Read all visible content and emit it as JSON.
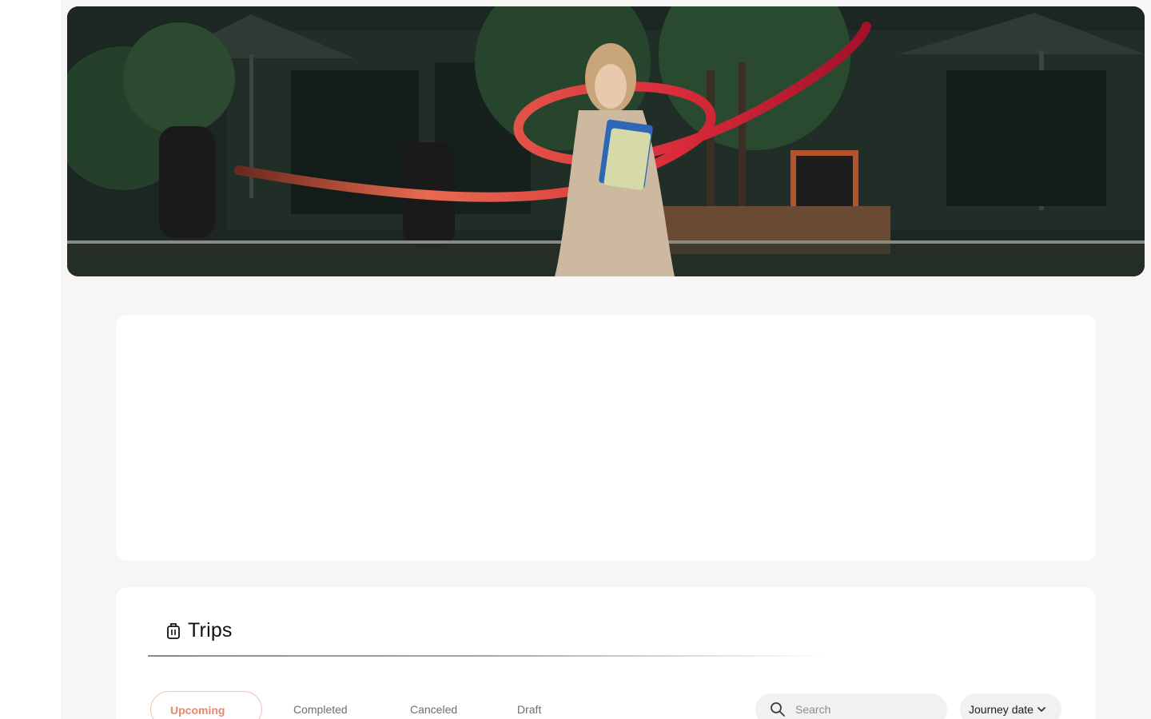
{
  "trips": {
    "title": "Trips",
    "tabs": [
      {
        "label": "Upcoming",
        "active": true
      },
      {
        "label": "Completed",
        "active": false
      },
      {
        "label": "Canceled",
        "active": false
      },
      {
        "label": "Draft",
        "active": false
      }
    ],
    "search": {
      "placeholder": "Search",
      "value": ""
    },
    "sort": {
      "label": "Journey date"
    }
  },
  "colors": {
    "accent": "#e8876a",
    "page_bg": "#f7f6f4",
    "card_bg": "#ffffff",
    "ribbon": "#c8102e"
  },
  "icons": {
    "trips": "luggage-icon",
    "search": "search-icon",
    "sort": "chevron-down-icon"
  }
}
